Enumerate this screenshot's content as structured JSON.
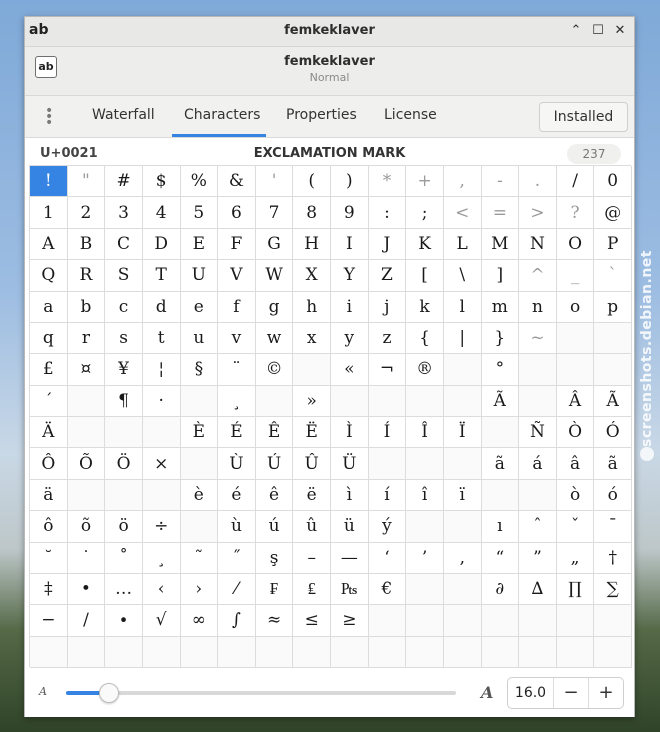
{
  "watermark": "screenshots.debian.net",
  "window": {
    "title": "femkeklaver",
    "logo_text": "ab",
    "buttons": {
      "minimize": "⌃",
      "maximize": "☐",
      "close": "✕"
    }
  },
  "header": {
    "font_icon_text": "ab",
    "font_name": "femkeklaver",
    "font_style": "Normal"
  },
  "tabs": [
    {
      "label": "Waterfall",
      "active": false
    },
    {
      "label": "Characters",
      "active": true
    },
    {
      "label": "Properties",
      "active": false
    },
    {
      "label": "License",
      "active": false
    }
  ],
  "installed_label": "Installed",
  "info": {
    "codepoint": "U+0021",
    "name": "EXCLAMATION MARK",
    "count": "237"
  },
  "glyphs": [
    "!",
    "\"",
    "#",
    "$",
    "%",
    "&",
    "'",
    "(",
    ")",
    "*",
    "+",
    ",",
    "-",
    ".",
    "/",
    "0",
    "1",
    "2",
    "3",
    "4",
    "5",
    "6",
    "7",
    "8",
    "9",
    ":",
    ";",
    "<",
    "=",
    ">",
    "?",
    "@",
    "A",
    "B",
    "C",
    "D",
    "E",
    "F",
    "G",
    "H",
    "I",
    "J",
    "K",
    "L",
    "M",
    "N",
    "O",
    "P",
    "Q",
    "R",
    "S",
    "T",
    "U",
    "V",
    "W",
    "X",
    "Y",
    "Z",
    "[",
    "\\",
    "]",
    "^",
    "_",
    "`",
    "a",
    "b",
    "c",
    "d",
    "e",
    "f",
    "g",
    "h",
    "i",
    "j",
    "k",
    "l",
    "m",
    "n",
    "o",
    "p",
    "q",
    "r",
    "s",
    "t",
    "u",
    "v",
    "w",
    "x",
    "y",
    "z",
    "{",
    "|",
    "}",
    "~",
    "",
    "",
    "£",
    "¤",
    "¥",
    "¦",
    "§",
    "¨",
    "©",
    "",
    "«",
    "¬",
    "®",
    "",
    "°",
    "",
    "",
    "",
    "´",
    "",
    "¶",
    "·",
    "",
    "¸",
    "",
    "»",
    "",
    "",
    "",
    "",
    "Ã",
    "",
    "Â",
    "Ã",
    "Ä",
    "",
    "",
    "",
    "È",
    "É",
    "Ê",
    "Ë",
    "Ì",
    "Í",
    "Î",
    "Ï",
    "",
    "Ñ",
    "Ò",
    "Ó",
    "Ô",
    "Õ",
    "Ö",
    "×",
    "",
    "Ù",
    "Ú",
    "Û",
    "Ü",
    "",
    "",
    "",
    "ã",
    "á",
    "â",
    "ã",
    "ä",
    "",
    "",
    "",
    "è",
    "é",
    "ê",
    "ë",
    "ì",
    "í",
    "î",
    "ï",
    "",
    "",
    "ò",
    "ó",
    "ô",
    "õ",
    "ö",
    "÷",
    "",
    "ù",
    "ú",
    "û",
    "ü",
    "ý",
    "",
    "",
    "ı",
    "ˆ",
    "ˇ",
    "¯",
    "˘",
    "˙",
    "˚",
    "¸",
    "˜",
    "˝",
    "ş",
    "–",
    "—",
    "‘",
    "’",
    "‚",
    "“",
    "”",
    "„",
    "†",
    "‡",
    "•",
    "…",
    "‹",
    "›",
    "⁄",
    "₣",
    "₤",
    "₧",
    "€",
    "",
    "",
    "∂",
    "∆",
    "∏",
    "∑",
    "−",
    "∕",
    "∙",
    "√",
    "∞",
    "∫",
    "≈",
    "≤",
    "≥",
    "",
    "",
    "",
    "",
    "",
    "",
    "",
    "",
    "",
    "",
    "",
    "",
    "",
    "",
    "",
    "",
    "",
    "",
    "",
    "",
    "",
    "",
    ""
  ],
  "size": {
    "small_a": "A",
    "big_a": "A",
    "value": "16.0",
    "minus": "−",
    "plus": "+",
    "slider_fraction": 0.11
  },
  "colors": {
    "accent": "#3584e4"
  }
}
